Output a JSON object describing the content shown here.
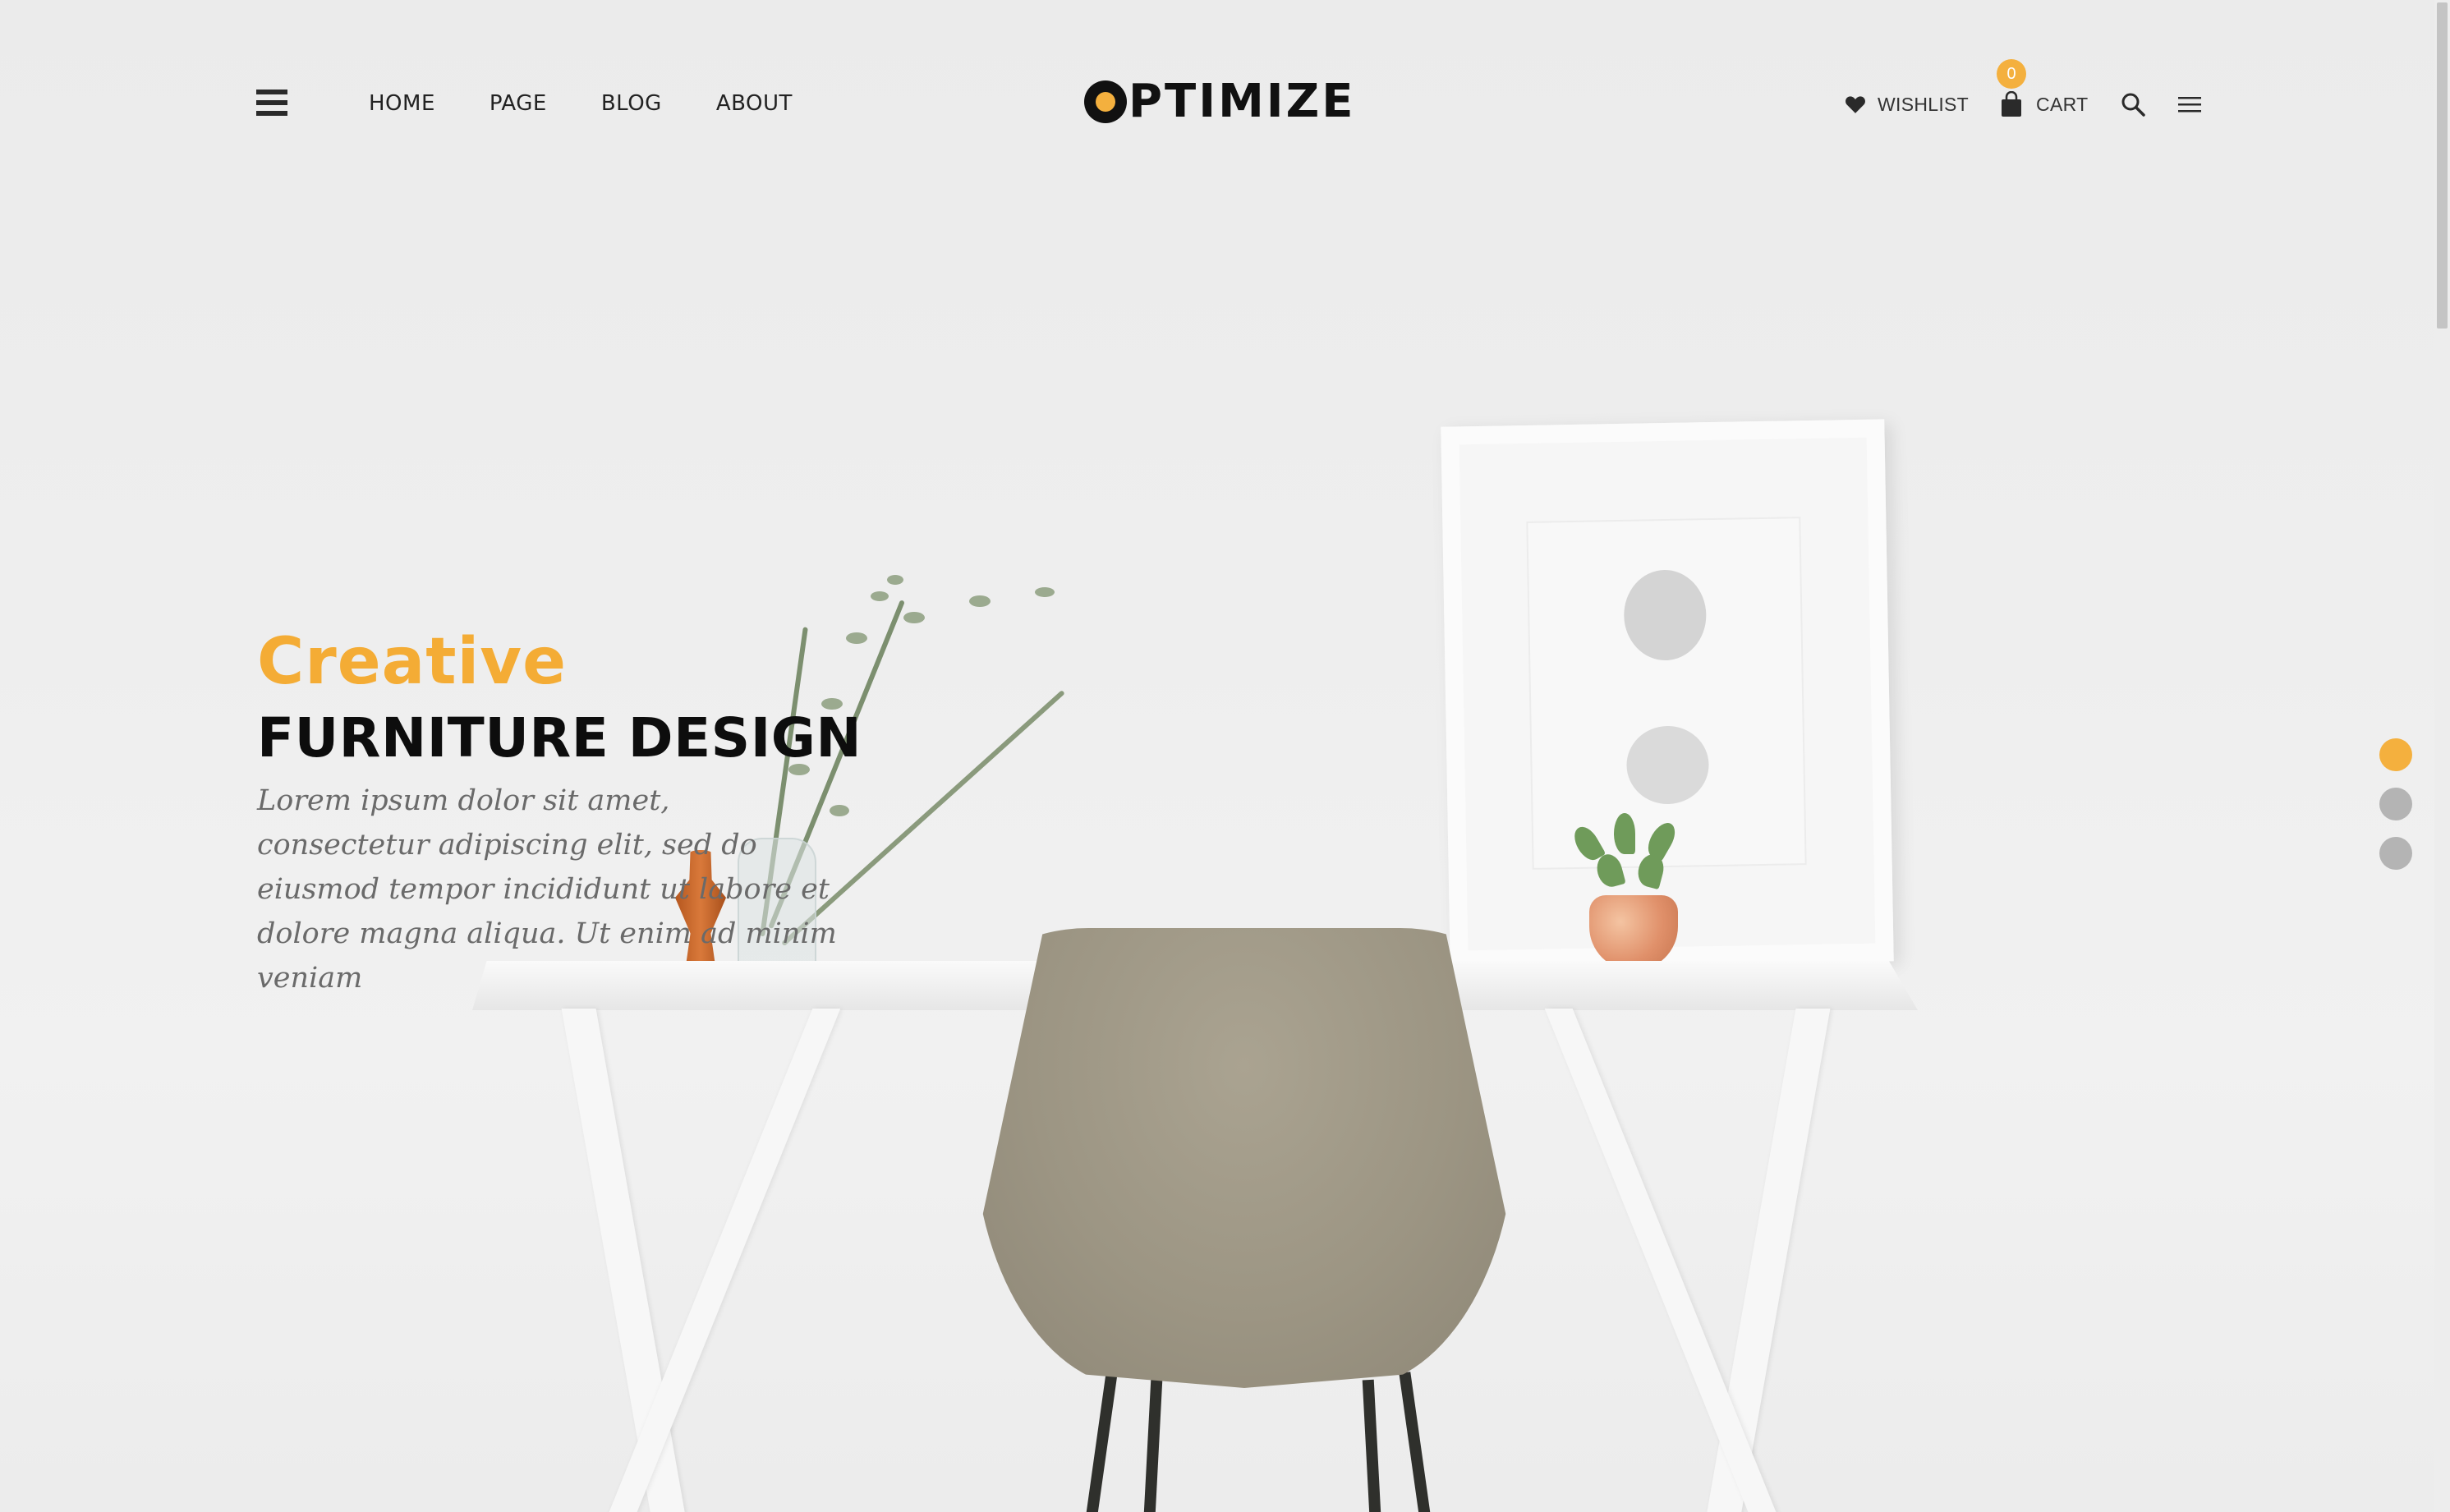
{
  "header": {
    "menu_icon": "hamburger-icon",
    "nav": [
      "HOME",
      "PAGE",
      "BLOG",
      "ABOUT"
    ],
    "logo": "OPTIMIZE",
    "wishlist_label": "WISHLIST",
    "wishlist_icon": "heart-icon",
    "cart_label": "CART",
    "cart_icon": "shopping-bag-icon",
    "cart_count": "0",
    "search_icon": "search-icon",
    "sidebar_icon": "menu-lines-icon"
  },
  "hero": {
    "kicker": "Creative",
    "title": "FURNITURE DESIGN",
    "description": "Lorem ipsum dolor sit amet, consectetur adipiscing elit, sed do eiusmod tempor incididunt ut labore et dolore magna aliqua. Ut enim ad minim veniam"
  },
  "slider": {
    "dot_count": 3,
    "active_dot": 1
  },
  "colors": {
    "accent": "#f4b03e",
    "text_dark": "#0d0d0d",
    "desc": "#6a6a6a",
    "dot_inactive": "#b4b4b4"
  }
}
